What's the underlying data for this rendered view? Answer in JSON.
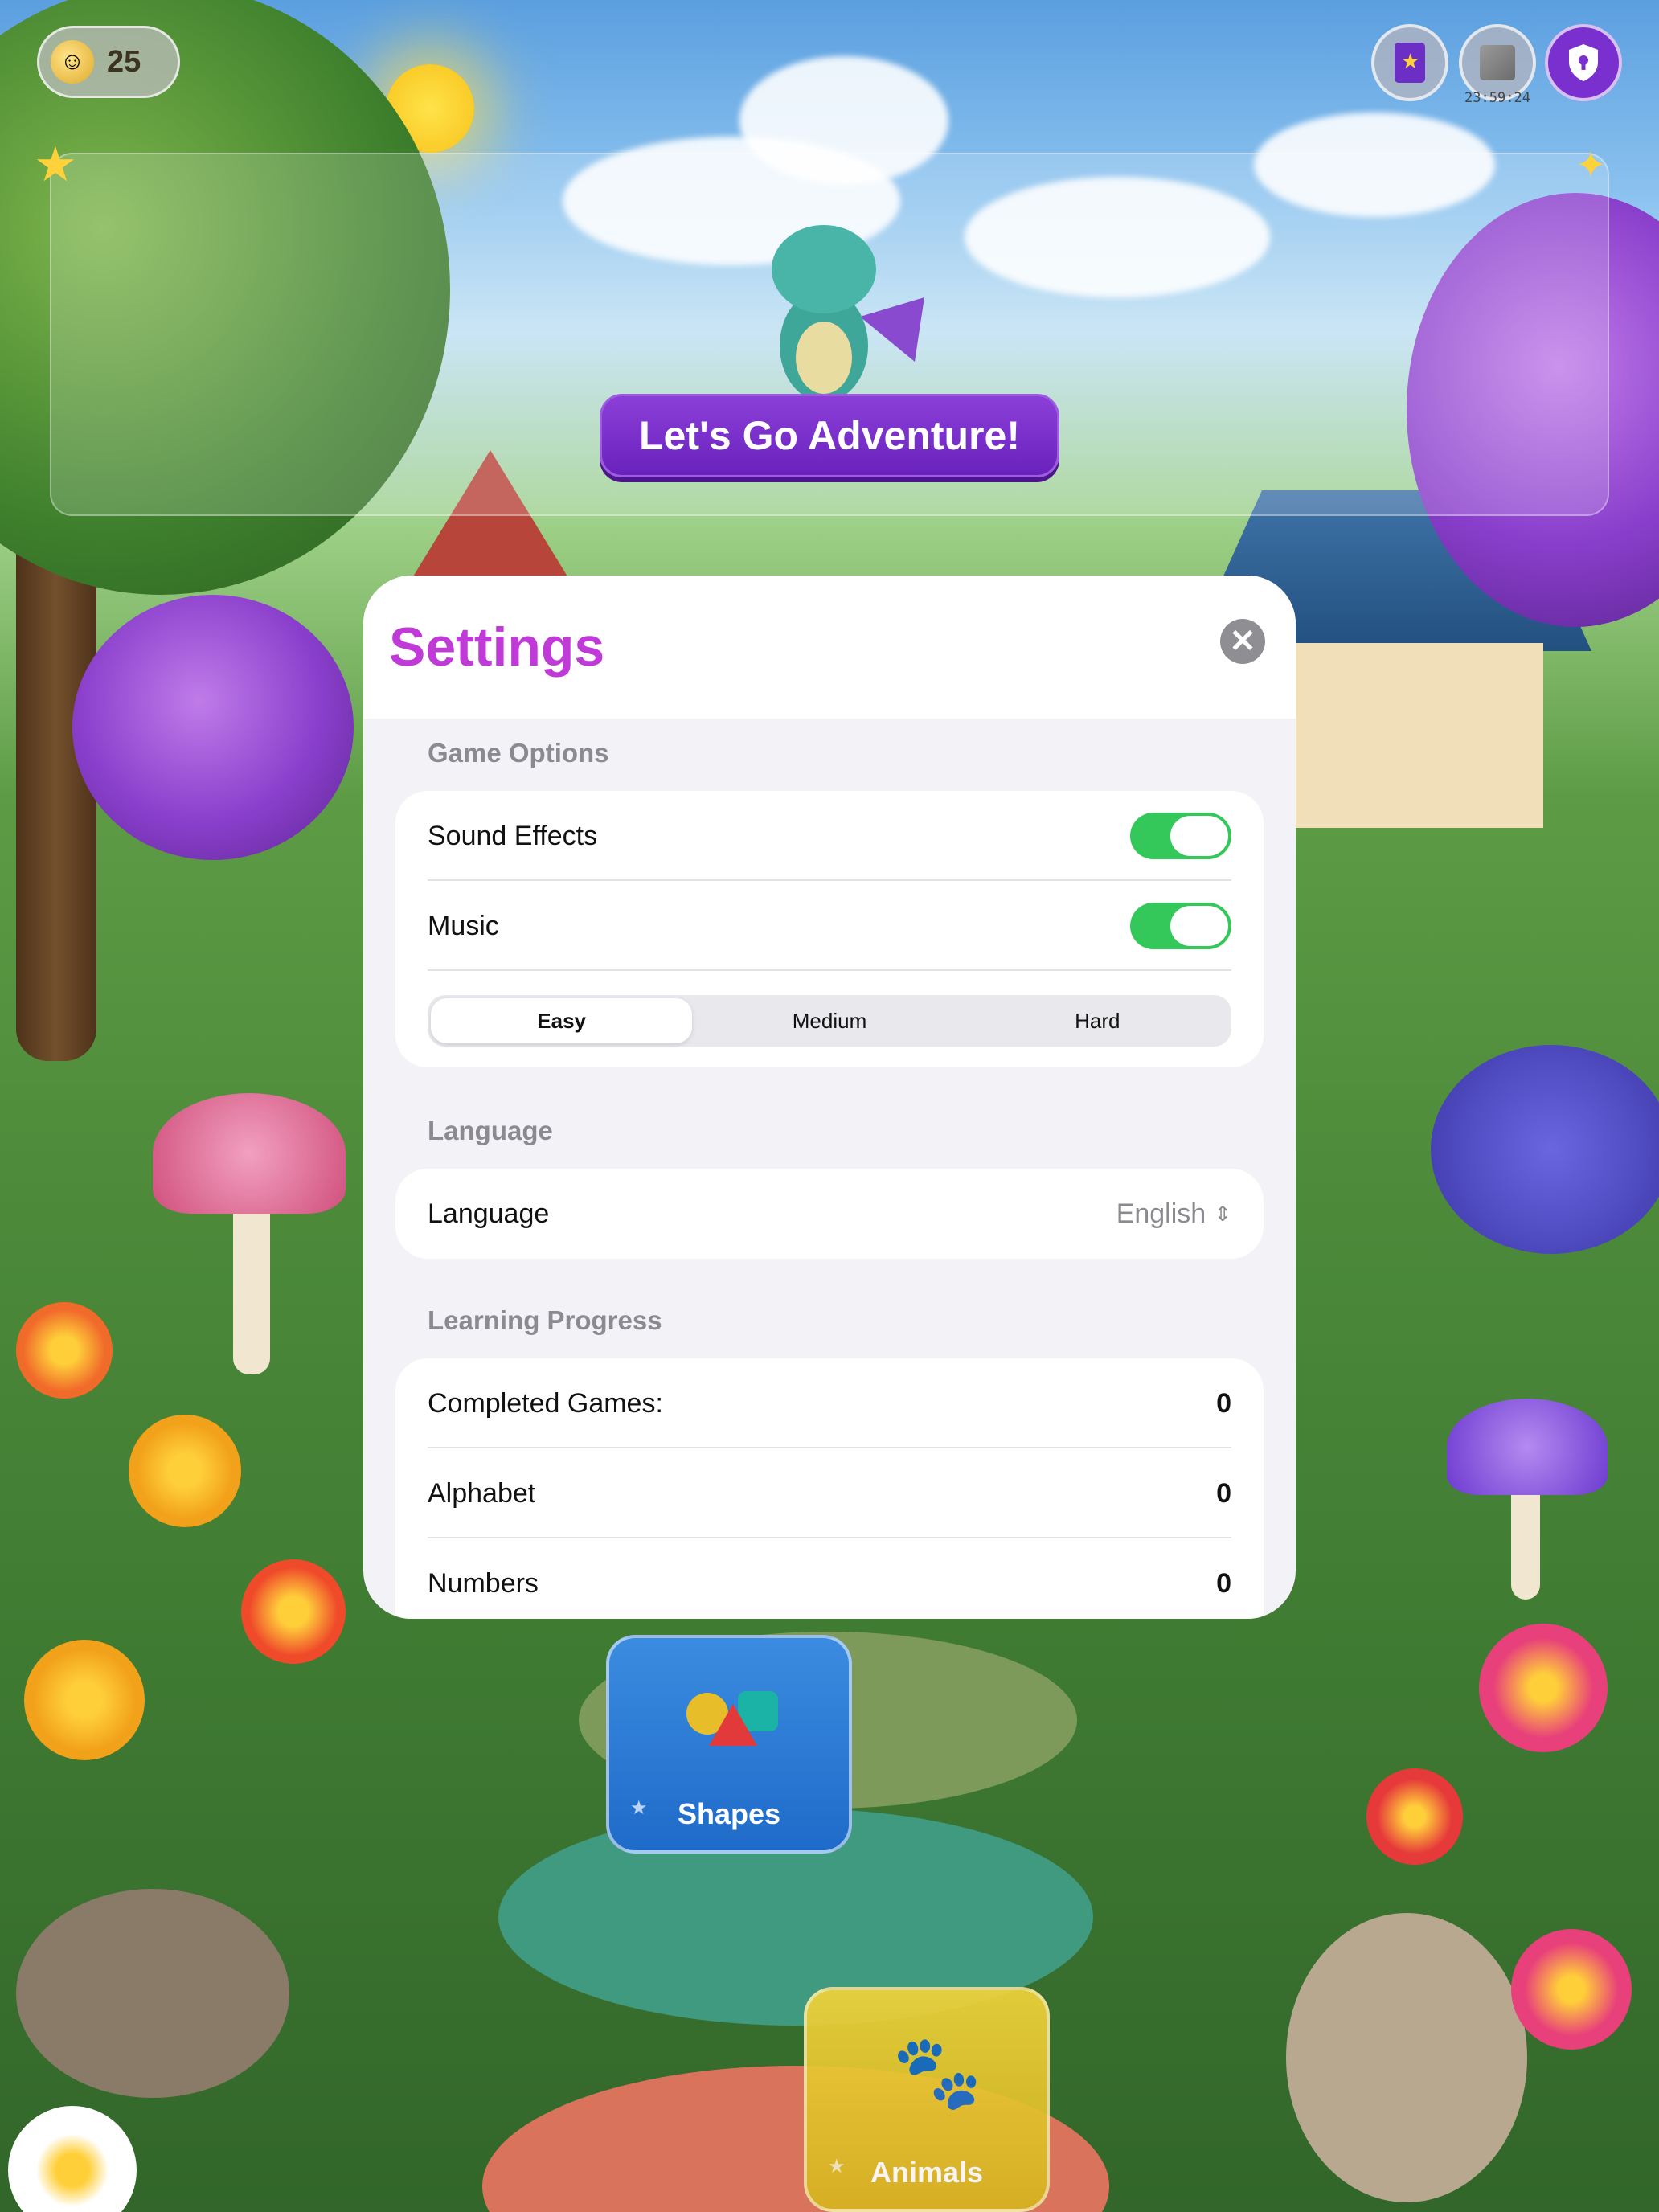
{
  "hud": {
    "coins": "25",
    "coin_icon": "coin-icon",
    "timer": "23:59:24",
    "buttons": [
      {
        "icon": "sticker-book-icon"
      },
      {
        "icon": "mystery-box-icon"
      },
      {
        "icon": "parental-shield-icon"
      }
    ]
  },
  "banner": {
    "cta_label": "Let's Go Adventure!"
  },
  "settings": {
    "title": "Settings",
    "close_icon": "close-icon",
    "game_options": {
      "title": "Game Options",
      "sound_effects": {
        "label": "Sound Effects",
        "on": true
      },
      "music": {
        "label": "Music",
        "on": true
      },
      "difficulty": {
        "options": [
          "Easy",
          "Medium",
          "Hard"
        ],
        "selected": "Easy"
      }
    },
    "language": {
      "title": "Language",
      "label": "Language",
      "value": "English"
    },
    "learning_progress": {
      "title": "Learning Progress",
      "rows": [
        {
          "label": "Completed Games:",
          "value": "0"
        },
        {
          "label": "Alphabet",
          "value": "0"
        },
        {
          "label": "Numbers",
          "value": "0"
        }
      ]
    }
  },
  "games": [
    {
      "label": "Shapes",
      "icon": "shapes-icon"
    },
    {
      "label": "Animals",
      "icon": "paw-icon"
    }
  ],
  "colors": {
    "accent_purple": "#7a2fcf",
    "title_magenta": "#c03ad8",
    "toggle_green": "#34c759"
  }
}
